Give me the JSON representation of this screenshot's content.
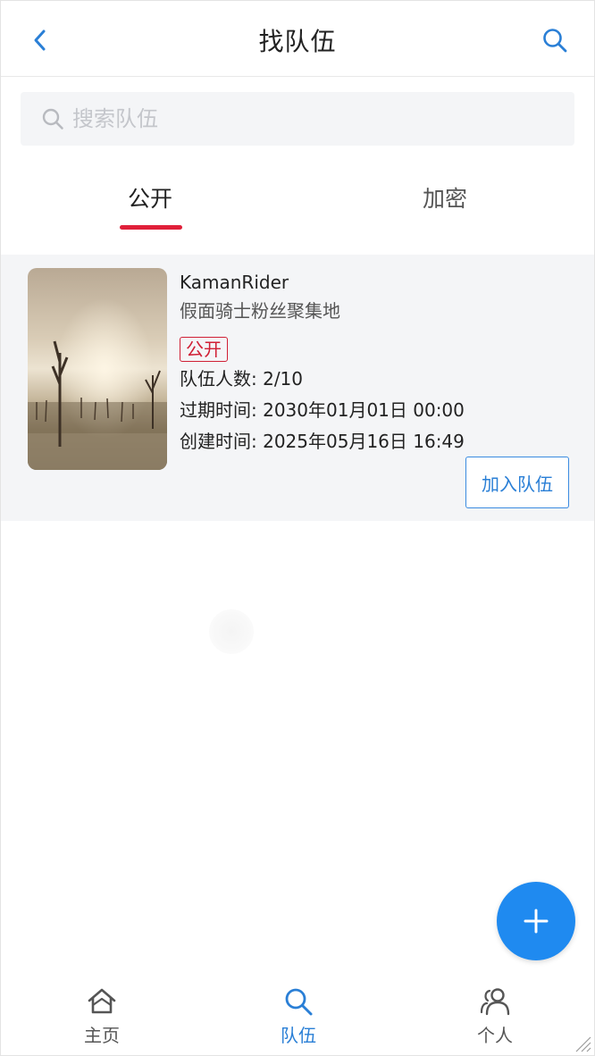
{
  "header": {
    "title": "找队伍",
    "back_icon": "chevron-left-icon",
    "search_icon": "search-icon"
  },
  "search": {
    "placeholder": "搜索队伍",
    "value": ""
  },
  "tabs": [
    {
      "label": "公开",
      "active": true
    },
    {
      "label": "加密",
      "active": false
    }
  ],
  "teams": [
    {
      "name": "KamanRider",
      "description": "假面骑士粉丝聚集地",
      "badge": "公开",
      "members": "队伍人数: 2/10",
      "expire": "过期时间: 2030年01月01日 00:00",
      "created": "创建时间: 2025年05月16日 16:49",
      "join_label": "加入队伍"
    }
  ],
  "fab": {
    "icon": "plus-icon"
  },
  "bottom_nav": [
    {
      "label": "主页",
      "icon": "home-icon",
      "active": false
    },
    {
      "label": "队伍",
      "icon": "search-icon",
      "active": true
    },
    {
      "label": "个人",
      "icon": "user-group-icon",
      "active": false
    }
  ],
  "colors": {
    "accent": "#1f8af0",
    "tab_underline": "#e0203a",
    "badge": "#d01f35",
    "card_bg": "#f4f5f7"
  }
}
